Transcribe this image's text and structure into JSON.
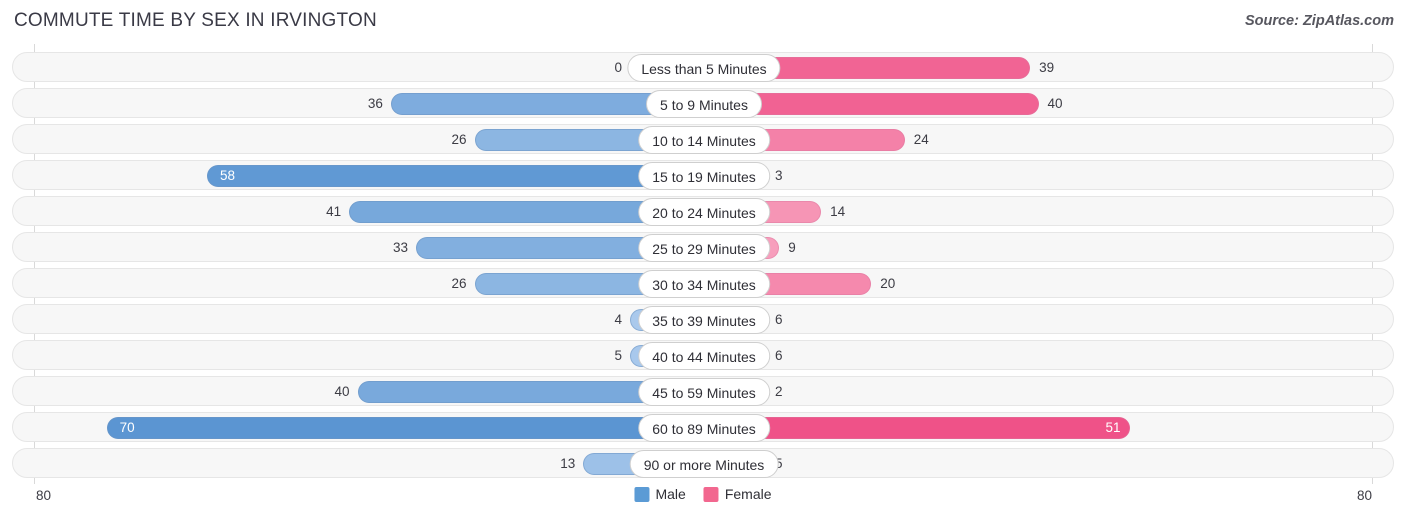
{
  "header": {
    "title": "COMMUTE TIME BY SEX IN IRVINGTON",
    "source": "Source: ZipAtlas.com"
  },
  "axis": {
    "left_end_label": "80",
    "right_end_label": "80"
  },
  "legend": {
    "items": [
      {
        "label": "Male",
        "color": "#5b9bd5"
      },
      {
        "label": "Female",
        "color": "#f2678f"
      }
    ]
  },
  "chart_data": {
    "type": "bar",
    "orientation": "horizontal-diverging",
    "title": "COMMUTE TIME BY SEX IN IRVINGTON",
    "xlabel": "",
    "ylabel": "",
    "xlim": [
      -80,
      80
    ],
    "axis_max": 80,
    "grid": false,
    "legend_position": "bottom-center",
    "categories": [
      "Less than 5 Minutes",
      "5 to 9 Minutes",
      "10 to 14 Minutes",
      "15 to 19 Minutes",
      "20 to 24 Minutes",
      "25 to 29 Minutes",
      "30 to 34 Minutes",
      "35 to 39 Minutes",
      "40 to 44 Minutes",
      "45 to 59 Minutes",
      "60 to 89 Minutes",
      "90 or more Minutes"
    ],
    "series": [
      {
        "name": "Male",
        "color": "#5b9bd5",
        "side": "left",
        "values": [
          0,
          36,
          26,
          58,
          41,
          33,
          26,
          4,
          5,
          40,
          70,
          13
        ]
      },
      {
        "name": "Female",
        "color": "#f2678f",
        "side": "right",
        "values": [
          39,
          40,
          24,
          3,
          14,
          9,
          20,
          6,
          6,
          2,
          51,
          5
        ]
      }
    ]
  }
}
